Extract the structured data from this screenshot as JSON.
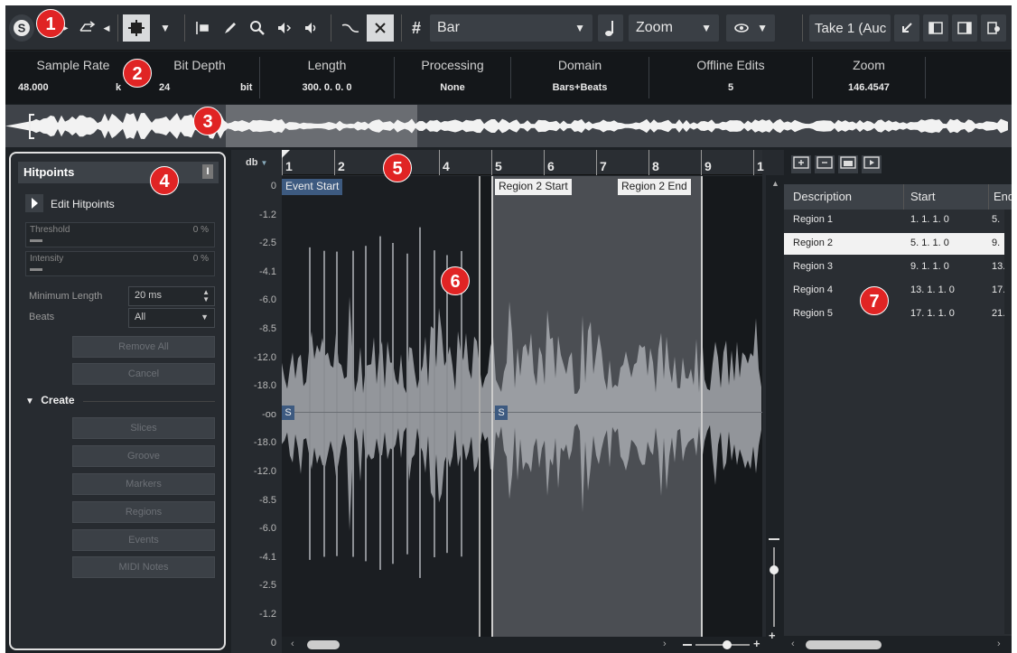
{
  "toolbar": {
    "ruler_format": "Bar",
    "zoom_label": "Zoom",
    "take_label": "Take 1 (Auc"
  },
  "info_line": [
    {
      "label": "Sample Rate",
      "value": "48.000"
    },
    {
      "label": "Bit Depth",
      "value": "24"
    },
    {
      "label": "Length",
      "value": "300. 0. 0. 0"
    },
    {
      "label": "Processing",
      "value": "None"
    },
    {
      "label": "Domain",
      "value": "Bars+Beats"
    },
    {
      "label": "Offline Edits",
      "value": "5"
    },
    {
      "label": "Zoom",
      "value": "146.4547"
    }
  ],
  "info_units": {
    "sample_rate": "k",
    "bit_depth": "bit"
  },
  "hitpoints": {
    "title": "Hitpoints",
    "edit_label": "Edit Hitpoints",
    "threshold_label": "Threshold",
    "threshold_value": "0 %",
    "intensity_label": "Intensity",
    "intensity_value": "0 %",
    "min_length_label": "Minimum Length",
    "min_length_value": "20 ms",
    "beats_label": "Beats",
    "beats_value": "All",
    "remove_all": "Remove All",
    "cancel": "Cancel",
    "create_label": "Create",
    "create_buttons": [
      "Slices",
      "Groove",
      "Markers",
      "Regions",
      "Events",
      "MIDI Notes"
    ]
  },
  "ruler": {
    "unit": "db",
    "bars": [
      "1",
      "2",
      "4",
      "5",
      "6",
      "7",
      "8",
      "9",
      "1"
    ]
  },
  "db_scale": [
    "0",
    "-1.2",
    "-2.5",
    "-4.1",
    "-6.0",
    "-8.5",
    "-12.0",
    "-18.0",
    "-oo",
    "-18.0",
    "-12.0",
    "-8.5",
    "-6.0",
    "-4.1",
    "-2.5",
    "-1.2",
    "0"
  ],
  "markers": {
    "event_start": "Event Start",
    "region2_start": "Region 2 Start",
    "region2_end": "Region 2 End",
    "sync_label": "S"
  },
  "regions_table": {
    "headers": [
      "Description",
      "Start",
      "End"
    ],
    "rows": [
      {
        "description": "Region 1",
        "start": "1. 1. 1. 0",
        "end": "5."
      },
      {
        "description": "Region 2",
        "start": "5. 1. 1. 0",
        "end": "9."
      },
      {
        "description": "Region 3",
        "start": "9. 1. 1. 0",
        "end": "13."
      },
      {
        "description": "Region 4",
        "start": "13. 1. 1. 0",
        "end": "17."
      },
      {
        "description": "Region 5",
        "start": "17. 1. 1. 0",
        "end": "21."
      }
    ],
    "selected_index": 1
  },
  "callouts": [
    "1",
    "2",
    "3",
    "4",
    "5",
    "6",
    "7"
  ],
  "colors": {
    "background": "#1d2125",
    "callout": "#e02424",
    "waveform": "#a8abb0",
    "selected_region": "#4b4e53",
    "marker_tag": "#3d5a80"
  }
}
